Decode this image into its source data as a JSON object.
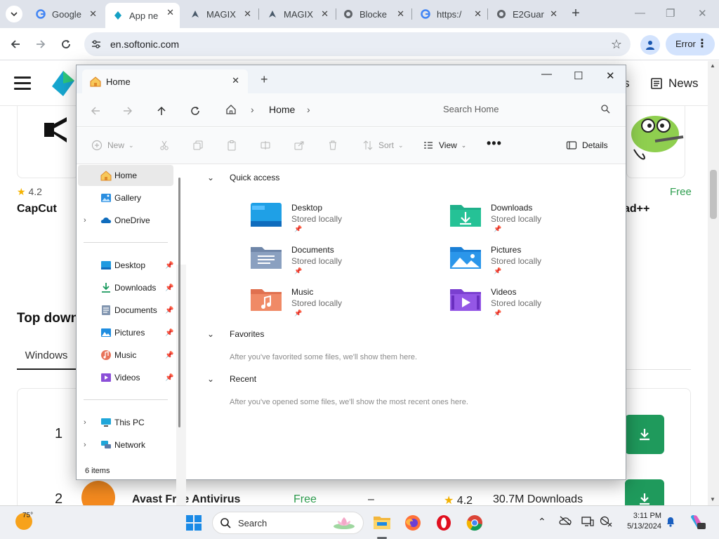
{
  "browser": {
    "tabs": [
      {
        "title": "Google",
        "icon": "google-icon"
      },
      {
        "title": "App ne",
        "icon": "softonic-icon"
      },
      {
        "title": "MAGIX",
        "icon": "magix-icon"
      },
      {
        "title": "MAGIX",
        "icon": "magix-icon"
      },
      {
        "title": "Blocke",
        "icon": "globe-icon"
      },
      {
        "title": "https:/",
        "icon": "google-icon"
      },
      {
        "title": "E2Guar",
        "icon": "globe-icon"
      }
    ],
    "url": "en.softonic.com",
    "error_label": "Error"
  },
  "site": {
    "nav_news": "News",
    "nav_partial": "s",
    "card1": {
      "rating": "4.2",
      "name": "CapCut"
    },
    "card2": {
      "price": "Free",
      "name_partial": "ad++"
    },
    "section_title_partial": "Top down",
    "filter_tab": "Windows",
    "rows": [
      {
        "rank": "1"
      },
      {
        "rank": "2",
        "name": "Avast Free Antivirus",
        "price": "Free",
        "dash": "–",
        "rating": "4.2",
        "downloads": "30.7M Downloads"
      }
    ]
  },
  "explorer": {
    "tab_title": "Home",
    "breadcrumb": "Home",
    "search_placeholder": "Search Home",
    "commands": {
      "new": "New",
      "sort": "Sort",
      "view": "View",
      "details": "Details"
    },
    "nav": {
      "home": "Home",
      "gallery": "Gallery",
      "onedrive": "OneDrive",
      "desktop": "Desktop",
      "downloads": "Downloads",
      "documents": "Documents",
      "pictures": "Pictures",
      "music": "Music",
      "videos": "Videos",
      "thispc": "This PC",
      "network": "Network"
    },
    "status": "6 items",
    "quick_access": {
      "title": "Quick access",
      "items": [
        {
          "name": "Desktop",
          "sub": "Stored locally"
        },
        {
          "name": "Downloads",
          "sub": "Stored locally"
        },
        {
          "name": "Documents",
          "sub": "Stored locally"
        },
        {
          "name": "Pictures",
          "sub": "Stored locally"
        },
        {
          "name": "Music",
          "sub": "Stored locally"
        },
        {
          "name": "Videos",
          "sub": "Stored locally"
        }
      ]
    },
    "favorites": {
      "title": "Favorites",
      "note": "After you've favorited some files, we'll show them here."
    },
    "recent": {
      "title": "Recent",
      "note": "After you've opened some files, we'll show the most recent ones here."
    }
  },
  "taskbar": {
    "temperature": "75°",
    "search": "Search",
    "time": "3:11 PM",
    "date": "5/13/2024"
  },
  "colors": {
    "accent": "#1a73e8",
    "softonic_green": "#1f9a5c",
    "folder_yellow": "#f2c14e"
  }
}
